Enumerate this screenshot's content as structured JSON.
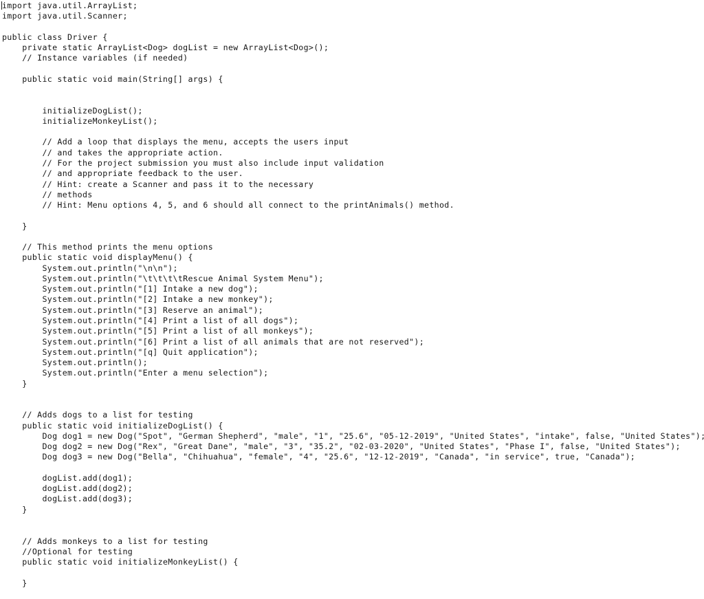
{
  "document": {
    "language": "java",
    "class_name": "Driver",
    "background_color": "#ffffff",
    "text_color": "#161616",
    "caret_line": 1,
    "caret_column": 0
  },
  "code": {
    "lines": [
      "import java.util.ArrayList;",
      "import java.util.Scanner;",
      "",
      "public class Driver {",
      "    private static ArrayList<Dog> dogList = new ArrayList<Dog>();",
      "    // Instance variables (if needed)",
      "",
      "    public static void main(String[] args) {",
      "",
      "",
      "        initializeDogList();",
      "        initializeMonkeyList();",
      "",
      "        // Add a loop that displays the menu, accepts the users input",
      "        // and takes the appropriate action.",
      "        // For the project submission you must also include input validation",
      "        // and appropriate feedback to the user.",
      "        // Hint: create a Scanner and pass it to the necessary",
      "        // methods",
      "        // Hint: Menu options 4, 5, and 6 should all connect to the printAnimals() method.",
      "",
      "    }",
      "",
      "    // This method prints the menu options",
      "    public static void displayMenu() {",
      "        System.out.println(\"\\n\\n\");",
      "        System.out.println(\"\\t\\t\\t\\tRescue Animal System Menu\");",
      "        System.out.println(\"[1] Intake a new dog\");",
      "        System.out.println(\"[2] Intake a new monkey\");",
      "        System.out.println(\"[3] Reserve an animal\");",
      "        System.out.println(\"[4] Print a list of all dogs\");",
      "        System.out.println(\"[5] Print a list of all monkeys\");",
      "        System.out.println(\"[6] Print a list of all animals that are not reserved\");",
      "        System.out.println(\"[q] Quit application\");",
      "        System.out.println();",
      "        System.out.println(\"Enter a menu selection\");",
      "    }",
      "",
      "",
      "    // Adds dogs to a list for testing",
      "    public static void initializeDogList() {",
      "        Dog dog1 = new Dog(\"Spot\", \"German Shepherd\", \"male\", \"1\", \"25.6\", \"05-12-2019\", \"United States\", \"intake\", false, \"United States\");",
      "        Dog dog2 = new Dog(\"Rex\", \"Great Dane\", \"male\", \"3\", \"35.2\", \"02-03-2020\", \"United States\", \"Phase I\", false, \"United States\");",
      "        Dog dog3 = new Dog(\"Bella\", \"Chihuahua\", \"female\", \"4\", \"25.6\", \"12-12-2019\", \"Canada\", \"in service\", true, \"Canada\");",
      "",
      "        dogList.add(dog1);",
      "        dogList.add(dog2);",
      "        dogList.add(dog3);",
      "    }",
      "",
      "",
      "    // Adds monkeys to a list for testing",
      "    //Optional for testing",
      "    public static void initializeMonkeyList() {",
      "",
      "    }"
    ]
  }
}
